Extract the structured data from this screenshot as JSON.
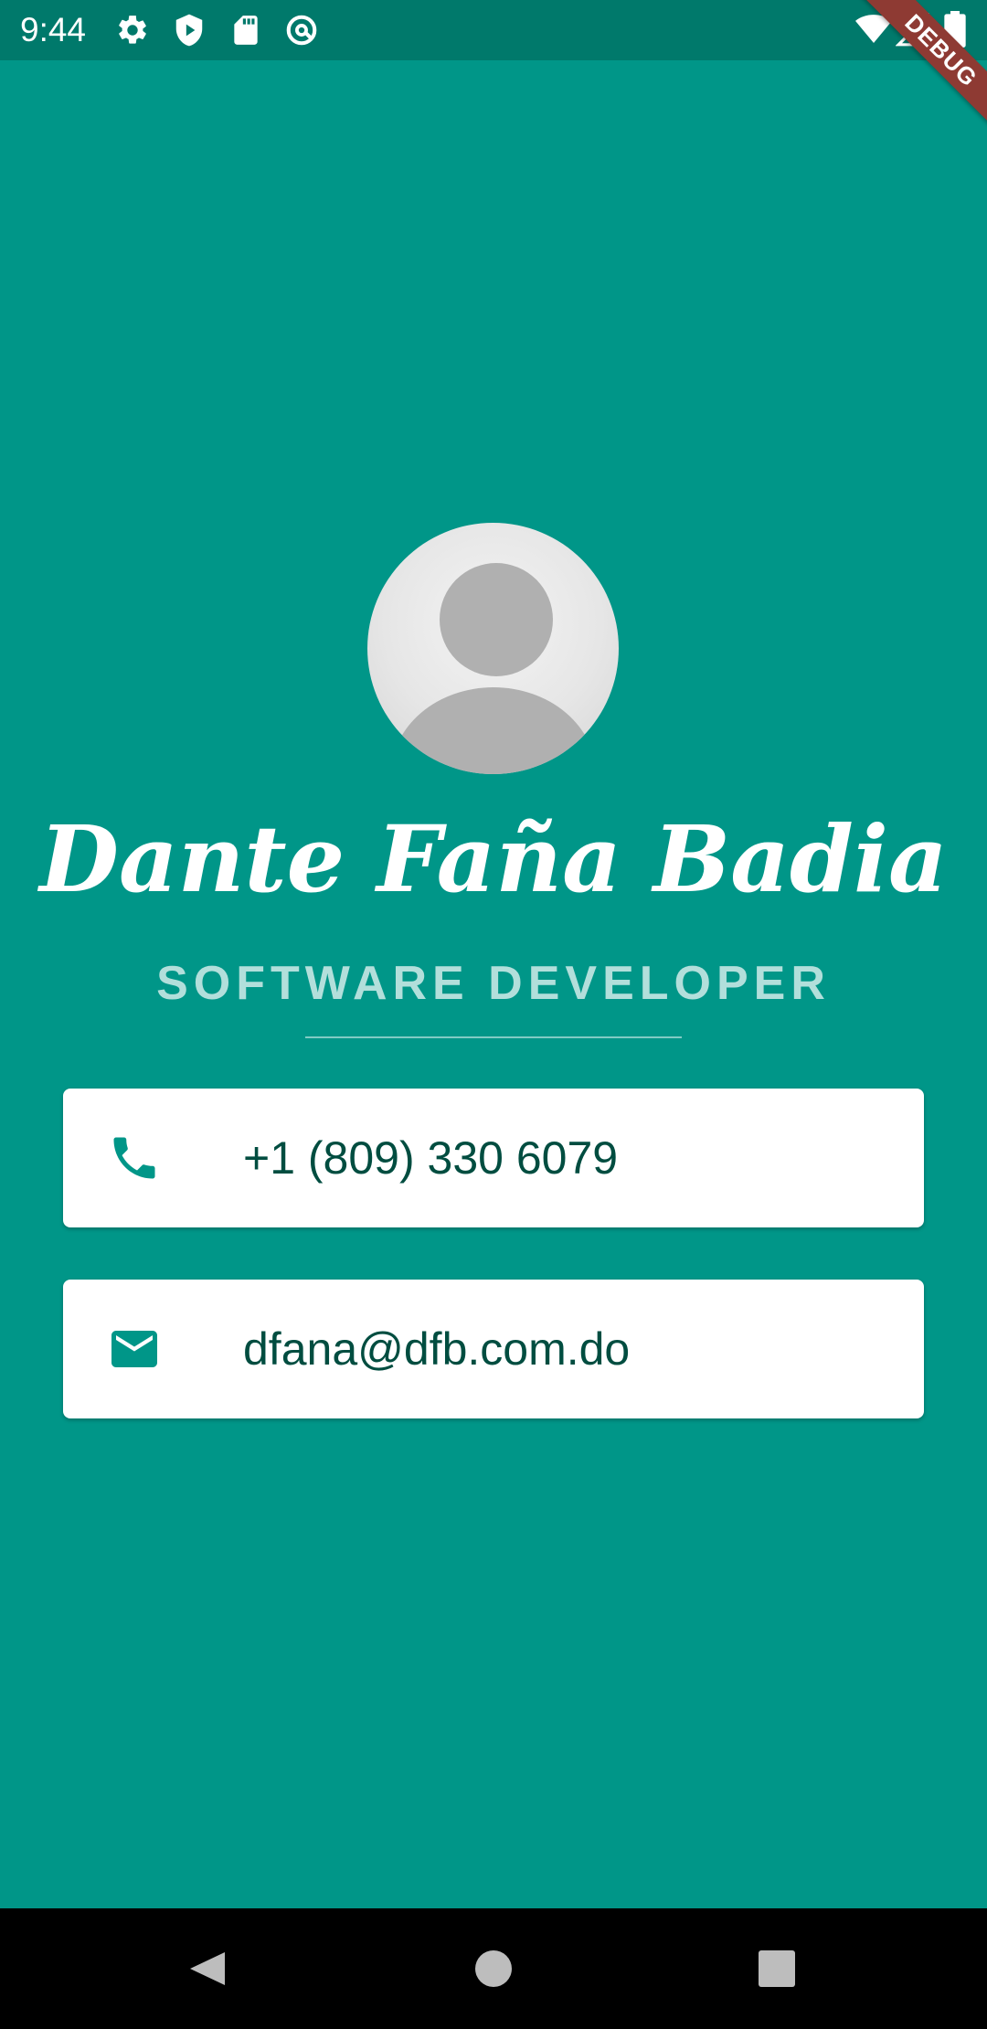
{
  "status_bar": {
    "time": "9:44",
    "left_icons": [
      "gear-icon",
      "play-protect-icon",
      "sd-card-icon",
      "at-sign-icon"
    ],
    "right_icons": [
      "wifi-icon",
      "cellular-signal-icon",
      "battery-icon"
    ]
  },
  "debug_banner": {
    "label": "DEBUG"
  },
  "profile": {
    "avatar_icon": "default-avatar-icon",
    "name": "Dante Faña Badia",
    "title": "SOFTWARE DEVELOPER"
  },
  "contacts": {
    "phone": {
      "icon": "phone-icon",
      "value": "+1 (809) 330 6079"
    },
    "email": {
      "icon": "email-icon",
      "value": "dfana@dfb.com.do"
    }
  },
  "nav_bar": {
    "buttons": [
      "back-icon",
      "home-icon",
      "recents-icon"
    ]
  },
  "colors": {
    "background": "#009688",
    "status_bar": "#00796b",
    "accent_text": "#004d40",
    "subtitle": "#b2dfdb",
    "card": "#ffffff",
    "debug_banner": "#8e3a33"
  }
}
